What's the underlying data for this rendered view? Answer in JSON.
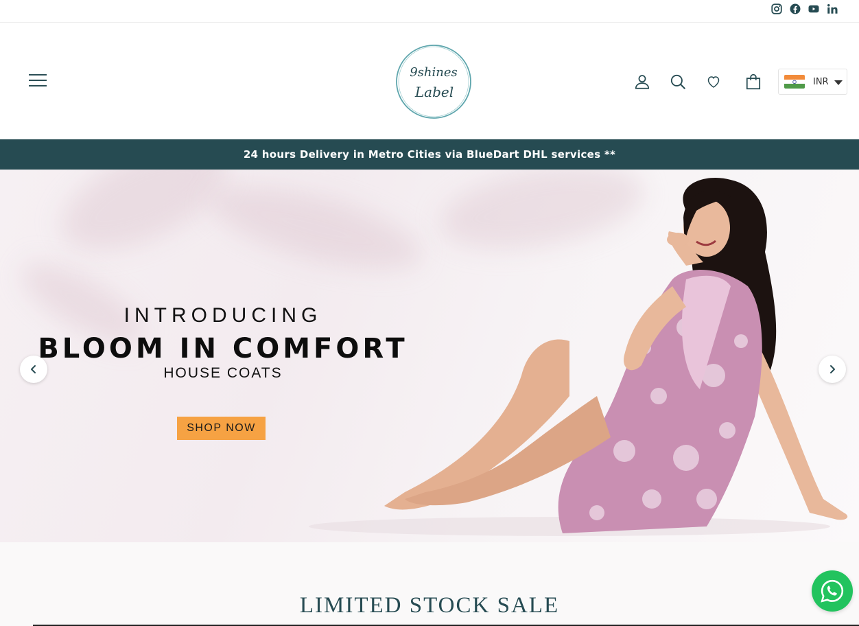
{
  "social": {
    "icons": [
      "instagram-icon",
      "facebook-icon",
      "youtube-icon",
      "linkedin-icon"
    ],
    "color": "#264b52"
  },
  "header": {
    "logo_line1": "9shines",
    "logo_line2": "Label",
    "icons": [
      "hamburger-menu-icon",
      "account-icon",
      "search-icon",
      "wishlist-heart-icon",
      "cart-bag-icon"
    ],
    "currency": {
      "code": "INR",
      "flag": "india-flag-icon"
    }
  },
  "announcement": {
    "text": "24 hours Delivery in Metro Cities via BlueDart DHL services **",
    "background": "#264b52"
  },
  "hero": {
    "eyebrow": "INTRODUCING",
    "headline": "BLOOM IN COMFORT",
    "subheadline": "HOUSE COATS",
    "cta_label": "SHOP NOW",
    "cta_color": "#f6a243",
    "prev_icon": "chevron-left-icon",
    "next_icon": "chevron-right-icon"
  },
  "sale_section": {
    "title": "LIMITED STOCK SALE"
  },
  "whatsapp": {
    "icon": "whatsapp-icon",
    "color": "#22c35e"
  }
}
